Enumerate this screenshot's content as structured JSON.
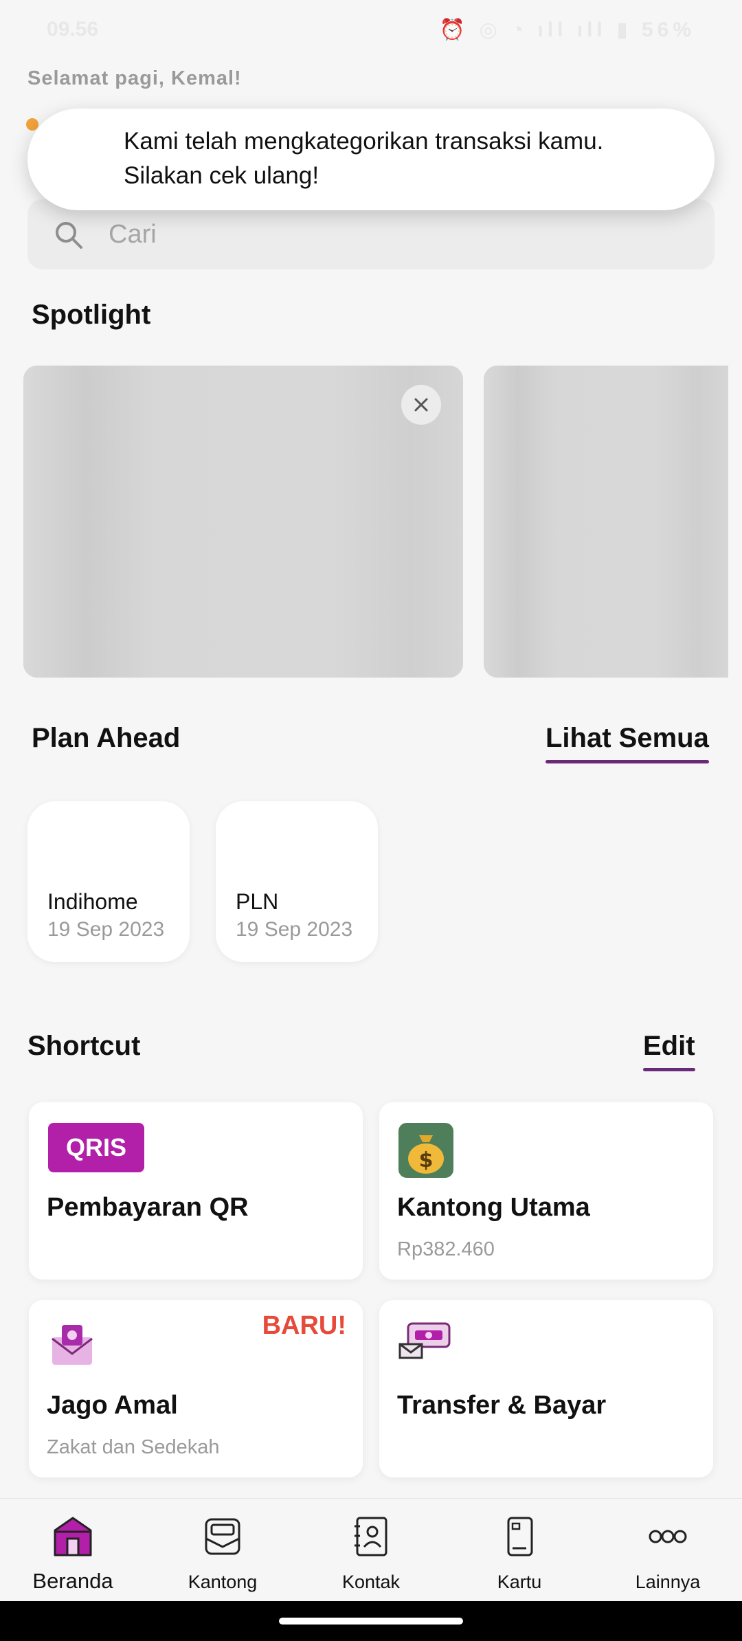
{
  "status_bar": {
    "time": "09.56",
    "battery": "56%"
  },
  "greeting": "Selamat pagi, Kemal!",
  "toast": {
    "line1": "Kami telah mengkategorikan transaksi kamu.",
    "line2": "Silakan cek ulang!"
  },
  "search": {
    "placeholder": "Cari"
  },
  "spotlight": {
    "title": "Spotlight"
  },
  "plan_ahead": {
    "title": "Plan Ahead",
    "see_all": "Lihat Semua",
    "items": [
      {
        "name": "Indihome",
        "date": "19 Sep 2023"
      },
      {
        "name": "PLN",
        "date": "19 Sep 2023"
      }
    ]
  },
  "shortcut": {
    "title": "Shortcut",
    "edit": "Edit",
    "items": [
      {
        "title": "Pembayaran QR",
        "icon": "qris-icon",
        "logo_text": "QRIS"
      },
      {
        "title": "Kantong Utama",
        "subtitle": "Rp382.460",
        "icon": "money-bag-icon"
      },
      {
        "title": "Jago Amal",
        "subtitle": "Zakat dan Sedekah",
        "badge": "BARU!",
        "icon": "envelope-icon"
      },
      {
        "title": "Transfer & Bayar",
        "icon": "transfer-icon"
      }
    ]
  },
  "bottom_nav": [
    {
      "label": "Beranda",
      "icon": "home-icon",
      "active": true
    },
    {
      "label": "Kantong",
      "icon": "pocket-icon"
    },
    {
      "label": "Kontak",
      "icon": "contacts-icon"
    },
    {
      "label": "Kartu",
      "icon": "card-icon"
    },
    {
      "label": "Lainnya",
      "icon": "more-icon"
    }
  ],
  "colors": {
    "accent": "#6a2a7a",
    "badge": "#e64a3a",
    "qris": "#b21fa8",
    "background": "#f6f6f6"
  }
}
